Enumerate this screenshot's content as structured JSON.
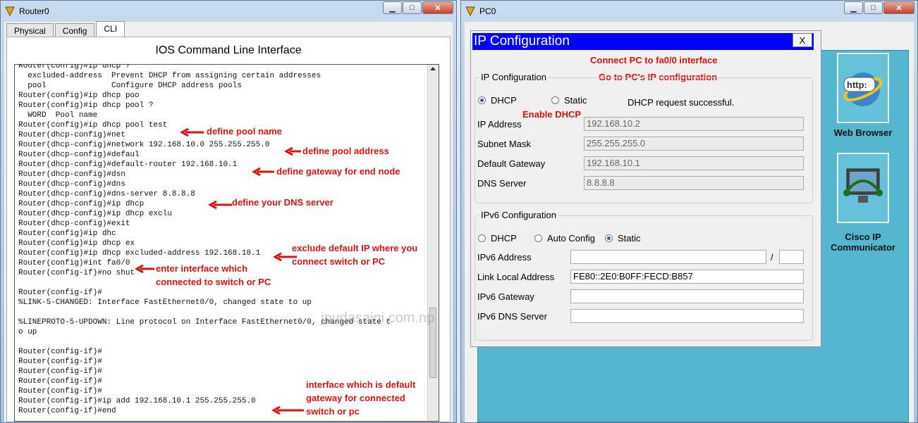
{
  "router_window": {
    "title": "Router0",
    "tabs": [
      "Physical",
      "Config",
      "CLI"
    ],
    "active_tab": "CLI",
    "cli_heading": "IOS Command Line Interface",
    "terminal_lines": [
      "Router(config)#ip dhcp ?",
      "  excluded-address  Prevent DHCP from assigning certain addresses",
      "  pool              Configure DHCP address pools",
      "Router(config)#ip dhcp poo",
      "Router(config)#ip dhcp pool ?",
      "  WORD  Pool name",
      "Router(config)#ip dhcp pool test",
      "Router(dhcp-config)#net",
      "Router(dhcp-config)#network 192.168.10.0 255.255.255.0",
      "Router(dhcp-config)#defaul",
      "Router(dhcp-config)#default-router 192.168.10.1",
      "Router(dhcp-config)#dsn",
      "Router(dhcp-config)#dns",
      "Router(dhcp-config)#dns-server 8.8.8.8",
      "Router(dhcp-config)#ip dhcp",
      "Router(dhcp-config)#ip dhcp exclu",
      "Router(dhcp-config)#exit",
      "Router(config)#ip dhc",
      "Router(config)#ip dhcp ex",
      "Router(config)#ip dhcp excluded-address 192.168.10.1",
      "Router(config)#int fa0/0",
      "Router(config-if)#no shut",
      "",
      "Router(config-if)#",
      "%LINK-5-CHANGED: Interface FastEthernet0/0, changed state to up",
      "",
      "%LINEPROTO-5-UPDOWN: Line protocol on Interface FastEthernet0/0, changed state t",
      "o up",
      "",
      "Router(config-if)#",
      "Router(config-if)#",
      "Router(config-if)#",
      "Router(config-if)#",
      "Router(config-if)#",
      "Router(config-if)#ip add 192.168.10.1 255.255.255.0",
      "Router(config-if)#end"
    ],
    "annotations": {
      "pool_name": "define pool name",
      "pool_address": "define pool address",
      "gateway": "define gateway for end node",
      "dns": "define your DNS server",
      "exclude_1": "exclude default IP where you",
      "exclude_2": "connect switch or PC",
      "iface_1": "enter interface which",
      "iface_2": "connected to switch or PC",
      "gw_iface_1": "interface which is default",
      "gw_iface_2": "gateway for connected",
      "gw_iface_3": "switch or pc"
    }
  },
  "pc_window": {
    "title": "PC0",
    "dialog": {
      "title": "IP Configuration",
      "close_label": "X",
      "note_connect": "Connect PC to fa0/0 interface",
      "note_goto": "Go to PC's IP configuration",
      "note_enable": "Enable DHCP",
      "ipv4": {
        "group_label": "IP Configuration",
        "dhcp_label": "DHCP",
        "static_label": "Static",
        "mode": "DHCP",
        "status": "DHCP request successful.",
        "ip_label": "IP Address",
        "ip_value": "192.168.10.2",
        "mask_label": "Subnet Mask",
        "mask_value": "255.255.255.0",
        "gw_label": "Default Gateway",
        "gw_value": "192.168.10.1",
        "dns_label": "DNS Server",
        "dns_value": "8.8.8.8"
      },
      "ipv6": {
        "group_label": "IPv6 Configuration",
        "dhcp_label": "DHCP",
        "auto_label": "Auto Config",
        "static_label": "Static",
        "mode": "Static",
        "addr_label": "IPv6 Address",
        "addr_value": "",
        "prefix_sep": "/",
        "prefix_value": "",
        "link_local_label": "Link Local Address",
        "link_local_value": "FE80::2E0:B0FF:FECD:B857",
        "gw_label": "IPv6 Gateway",
        "gw_value": "",
        "dns_label": "IPv6 DNS Server",
        "dns_value": ""
      }
    },
    "desktop_apps": [
      {
        "label": "Web Browser",
        "icon": "web-browser-icon",
        "icon_text": "http:"
      },
      {
        "label": "Cisco IP Communicator",
        "icon": "ip-communicator-icon"
      }
    ]
  },
  "watermark": "jpudasaini.com.np",
  "colors": {
    "annotation": "#e01010",
    "dialog_title": "#0000ff",
    "desktop": "#56b5cf"
  }
}
